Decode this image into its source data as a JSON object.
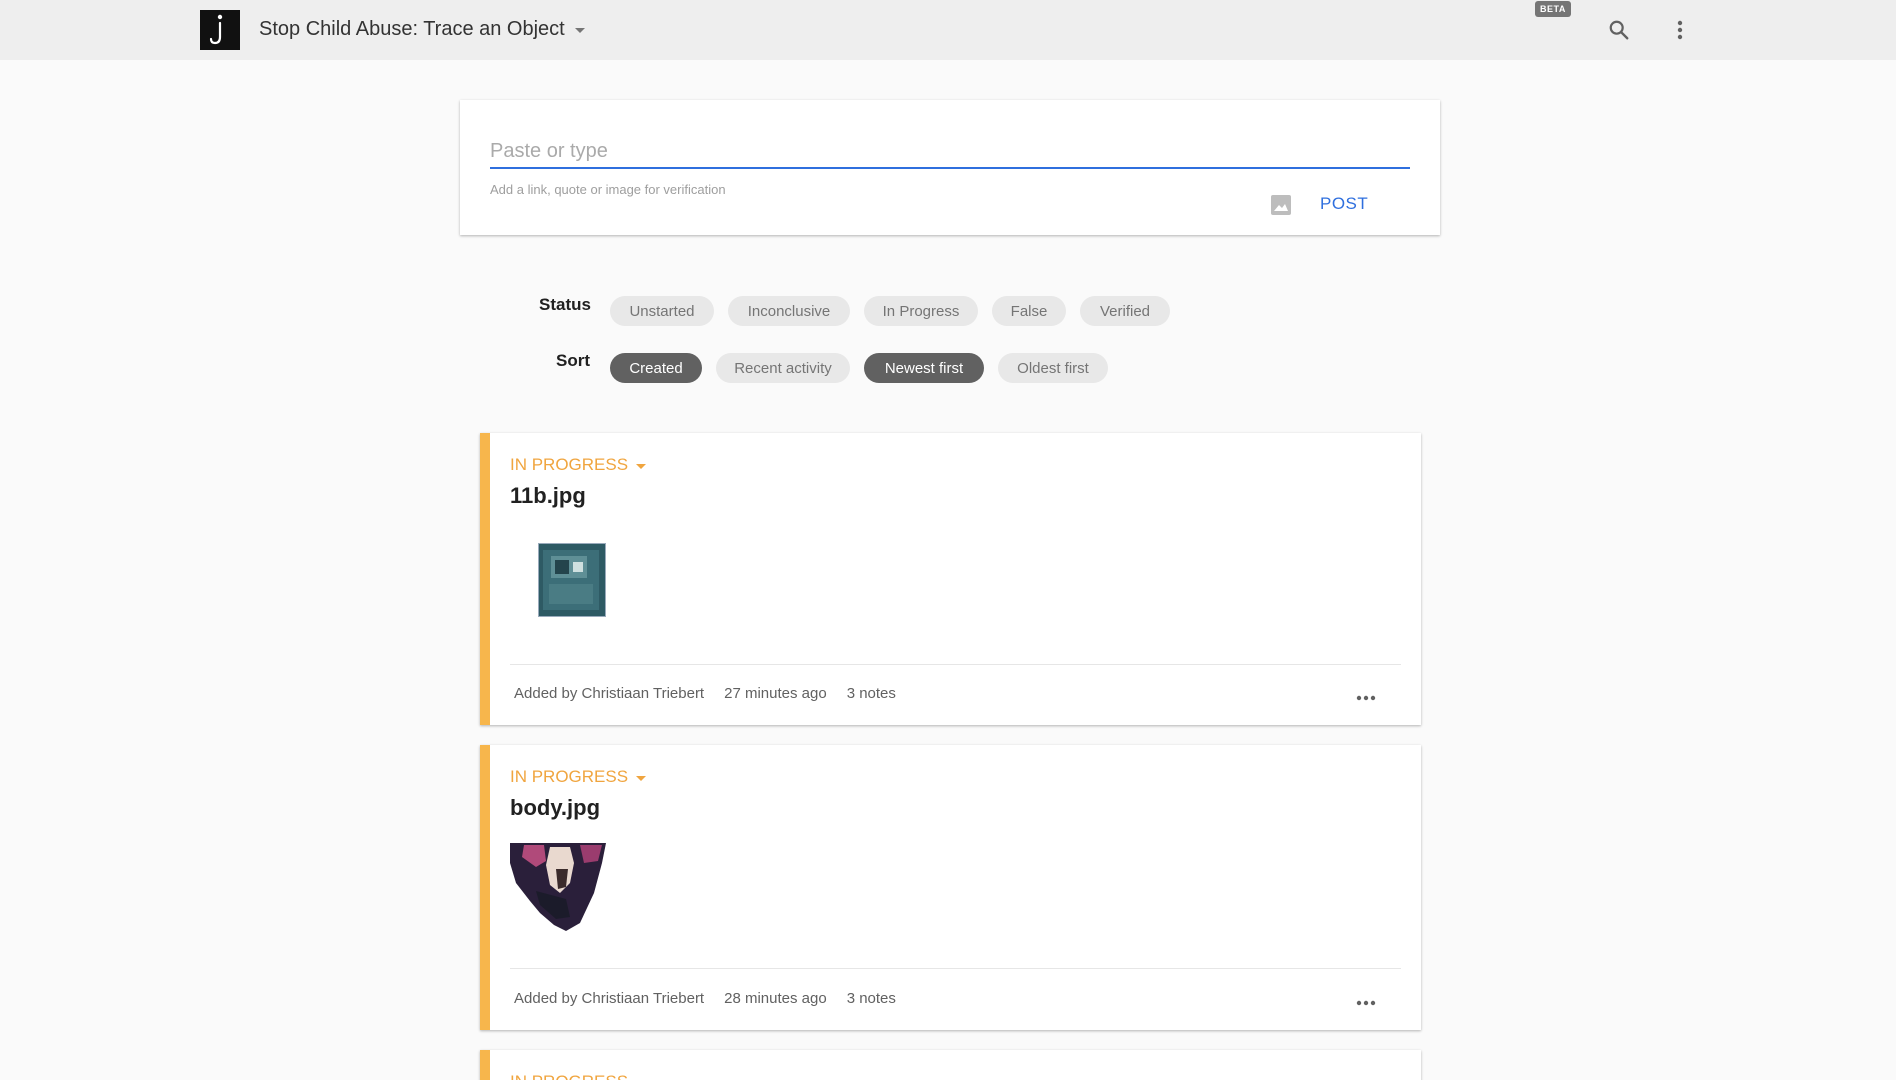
{
  "header": {
    "app_title": "Stop Child Abuse: Trace an Object",
    "beta_badge": "BETA",
    "icons": {
      "logo": "hook-question-icon",
      "search": "search-icon",
      "menu": "more-vertical-icon"
    }
  },
  "post": {
    "placeholder": "Paste or type",
    "hint": "Add a link, quote or image for verification",
    "post_label": "POST",
    "image_icon": "image-icon"
  },
  "filters": {
    "status_label": "Status",
    "status_options": [
      "Unstarted",
      "Inconclusive",
      "In Progress",
      "False",
      "Verified"
    ],
    "sort_label": "Sort",
    "sort_options": [
      "Created",
      "Recent activity",
      "Newest first",
      "Oldest first"
    ],
    "sort_selected": [
      "Created",
      "Newest first"
    ]
  },
  "items": [
    {
      "status": "IN PROGRESS",
      "title": "11b.jpg",
      "added_by": "Added by Christiaan Triebert",
      "time": "27 minutes ago",
      "notes": "3 notes"
    },
    {
      "status": "IN PROGRESS",
      "title": "body.jpg",
      "added_by": "Added by Christiaan Triebert",
      "time": "28 minutes ago",
      "notes": "3 notes"
    },
    {
      "status": "IN PROGRESS"
    }
  ],
  "colors": {
    "accent_blue": "#2f6fde",
    "in_progress": "#f0a53f",
    "stripe": "#f7b64c",
    "chip_selected": "#616161"
  }
}
